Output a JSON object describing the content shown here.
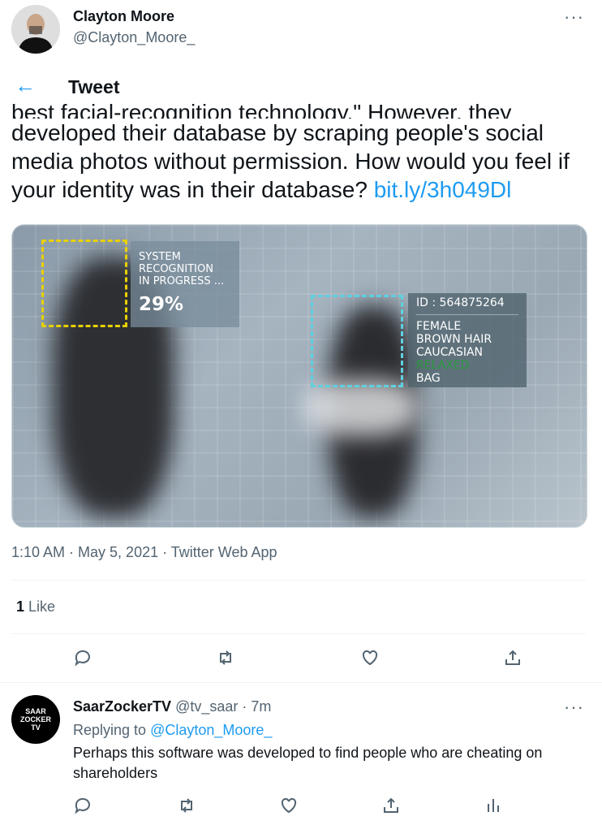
{
  "author": {
    "name": "Clayton Moore",
    "handle": "@Clayton_Moore_"
  },
  "header": {
    "title": "Tweet",
    "back_icon": "arrow-left-icon"
  },
  "tweet": {
    "partial_line": "best facial-recognition technology.\" However, they",
    "text": "developed their database by scraping people's social media photos without permission. How would you feel if your identity was in their database? ",
    "link": "bit.ly/3h049Dl",
    "meta": "1:10 AM · May 5, 2021 · Twitter Web App",
    "likes_count": "1",
    "likes_label": "Like"
  },
  "media": {
    "panel1": {
      "line1": "SYSTEM",
      "line2": "RECOGNITION",
      "line3": "IN PROGRESS ...",
      "percent": "29%"
    },
    "panel2": {
      "id": "ID : 564875264",
      "l1": "FEMALE",
      "l2": "BROWN HAIR",
      "l3": "CAUCASIAN",
      "l4": "RELAXED",
      "l5": "BAG"
    }
  },
  "actions": [
    "reply-icon",
    "retweet-icon",
    "like-icon",
    "share-icon"
  ],
  "reply": {
    "avatar_text": "SAAR ZOCKER TV",
    "name": "SaarZockerTV",
    "handle_time": "@tv_saar · 7m",
    "replying_prefix": "Replying to ",
    "replying_handle": "@Clayton_Moore_",
    "body": "Perhaps this software was developed to find people who are cheating on shareholders"
  },
  "colors": {
    "accent": "#1d9bf0",
    "text": "#0f1419",
    "muted": "#536471"
  }
}
